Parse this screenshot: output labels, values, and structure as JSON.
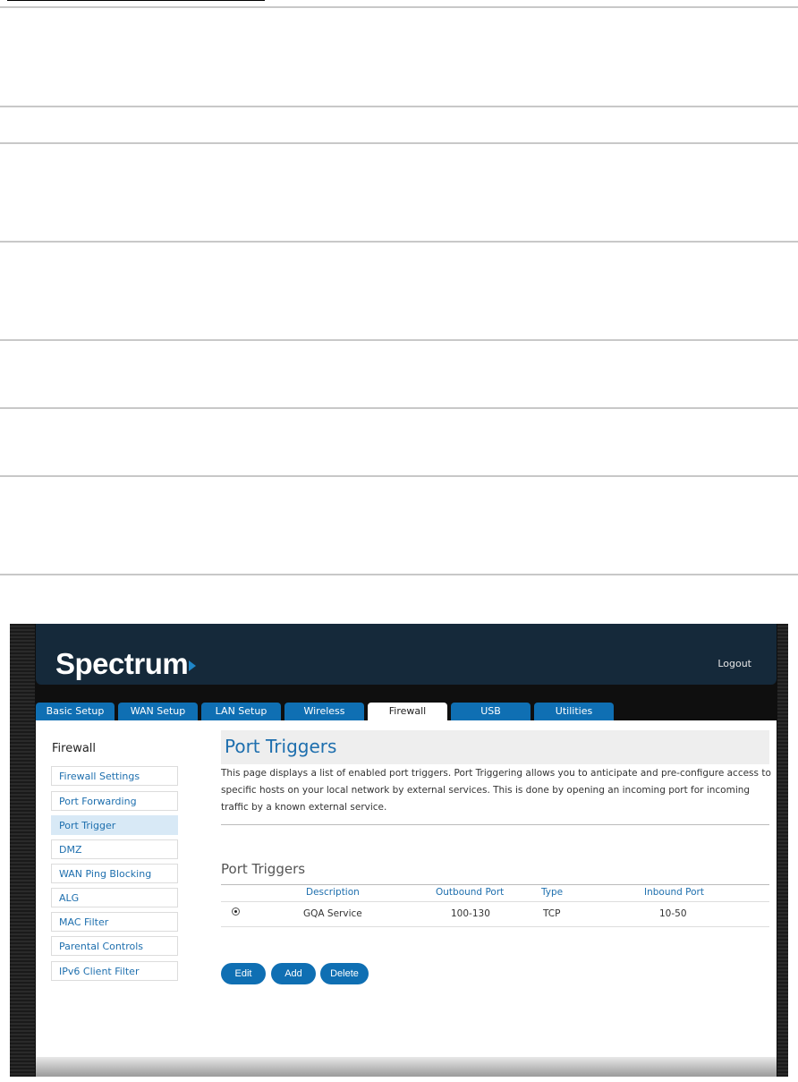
{
  "app": {
    "brand": "Spectrum",
    "logout": "Logout"
  },
  "tabs": [
    {
      "label": "Basic Setup"
    },
    {
      "label": "WAN Setup"
    },
    {
      "label": "LAN Setup"
    },
    {
      "label": "Wireless"
    },
    {
      "label": "Firewall",
      "active": true
    },
    {
      "label": "USB"
    },
    {
      "label": "Utilities"
    }
  ],
  "sidebar": {
    "title": "Firewall",
    "items": [
      {
        "label": "Firewall Settings"
      },
      {
        "label": "Port Forwarding"
      },
      {
        "label": "Port Trigger",
        "active": true
      },
      {
        "label": "DMZ"
      },
      {
        "label": "WAN Ping Blocking"
      },
      {
        "label": "ALG"
      },
      {
        "label": "MAC Filter"
      },
      {
        "label": "Parental Controls"
      },
      {
        "label": "IPv6 Client Filter"
      }
    ]
  },
  "main": {
    "title": "Port Triggers",
    "description": "This page displays a list of enabled port triggers. Port Triggering allows you to anticipate and pre-configure access to specific hosts on your local network by external services. This is done by opening an incoming port for incoming traffic by a known external service.",
    "section_title": "Port Triggers",
    "table": {
      "headers": [
        "Description",
        "Outbound Port",
        "Type",
        "Inbound Port"
      ],
      "rows": [
        {
          "selected": true,
          "description": "GQA Service",
          "outbound_port": "100-130",
          "type": "TCP",
          "inbound_port": "10-50"
        }
      ]
    },
    "buttons": {
      "edit": "Edit",
      "add": "Add",
      "delete": "Delete"
    }
  },
  "colors": {
    "header_bg": "#15293a",
    "tab_bg": "#0f6fb3",
    "accent": "#1e6fae",
    "sidebar_active_bg": "#d8e9f6"
  },
  "icons": {
    "brand_arrow": "play-triangle-icon",
    "row_select": "radio-icon"
  }
}
